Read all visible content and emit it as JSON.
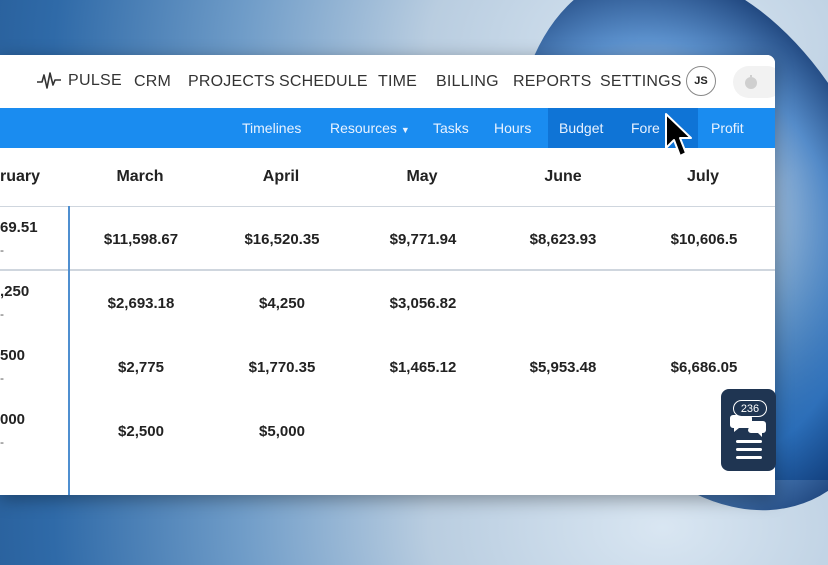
{
  "nav": {
    "brand": "PULSE",
    "items": [
      "CRM",
      "PROJECTS",
      "SCHEDULE",
      "TIME",
      "BILLING",
      "REPORTS",
      "SETTINGS"
    ],
    "avatar_initials": "JS"
  },
  "subnav": {
    "items": [
      "Timelines",
      "Resources",
      "Tasks",
      "Hours",
      "Budget",
      "Fore",
      "Profit"
    ],
    "active": "Forecast"
  },
  "table": {
    "columns": [
      "ruary",
      "March",
      "April",
      "May",
      "June",
      "July"
    ],
    "rows": [
      {
        "partial": "69.51",
        "dash": "-",
        "cells": [
          "$11,598.67",
          "$16,520.35",
          "$9,771.94",
          "$8,623.93",
          "$10,606.5"
        ]
      },
      {
        "partial": ",250",
        "dash": "-",
        "cells": [
          "$2,693.18",
          "$4,250",
          "$3,056.82",
          "",
          ""
        ]
      },
      {
        "partial": "500",
        "dash": "-",
        "cells": [
          "$2,775",
          "$1,770.35",
          "$1,465.12",
          "$5,953.48",
          "$6,686.05"
        ]
      },
      {
        "partial": "000",
        "dash": "-",
        "cells": [
          "$2,500",
          "$5,000",
          "",
          "",
          ""
        ]
      }
    ]
  },
  "chat": {
    "count": "236"
  },
  "colors": {
    "subnav_bg": "#1a8cf0",
    "subnav_active": "#0f74d6",
    "chat_bg": "#1f3552",
    "divider": "#4f8fd0"
  }
}
